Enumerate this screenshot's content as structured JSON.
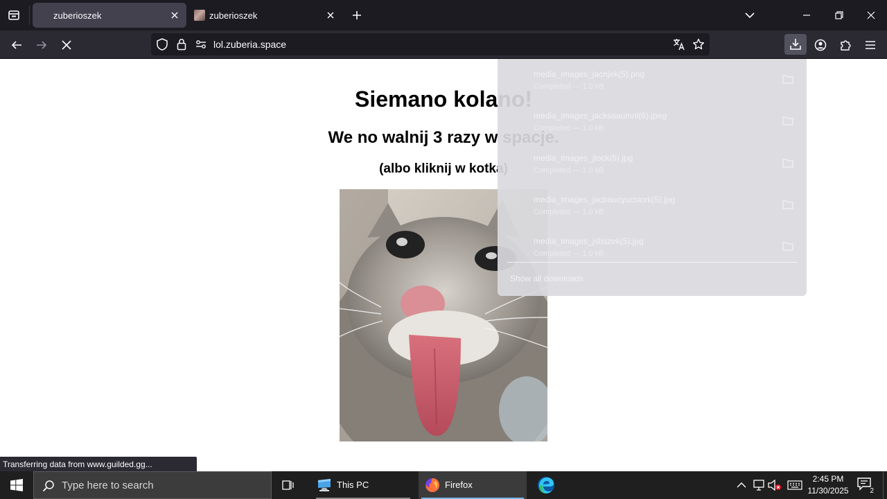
{
  "browser": {
    "tabs": [
      {
        "title": "zuberioszek",
        "active": true
      },
      {
        "title": "zuberioszek",
        "active": false
      }
    ],
    "url": "lol.zuberia.space",
    "status": "Transferring data from www.guilded.gg...",
    "downloads": {
      "items": [
        {
          "name": "media_images_jacnjek(5).png",
          "status": "Completed — 1.0 kB"
        },
        {
          "name": "media_images_jacksaaumni(6).jpeg",
          "status": "Completed — 1.0 kB"
        },
        {
          "name": "media_images_jtock(5).jpg",
          "status": "Completed — 1.0 kB"
        },
        {
          "name": "media_images_jacbaucyucsiork(5).jpg",
          "status": "Completed — 1.0 kB"
        },
        {
          "name": "media_images_jsbszek(5).jpg",
          "status": "Completed — 1.0 kB"
        }
      ],
      "show_all": "Show all downloads"
    }
  },
  "page": {
    "title": "Siemano kolano!",
    "subtitle": "We no walnij 3 razy w spacje.",
    "hint": "(albo kliknij w kotka)"
  },
  "taskbar": {
    "search_placeholder": "Type here to search",
    "apps": [
      {
        "label": "This PC"
      },
      {
        "label": "Firefox"
      }
    ],
    "time": "2:45 PM",
    "date": "11/30/2025",
    "notification_count": "2"
  },
  "colors": {
    "tabbar": "#1c1b22",
    "navbar": "#2b2a33",
    "active_tab": "#42414d",
    "taskbar": "#1f1f1f",
    "accent": "#76b9ed"
  }
}
